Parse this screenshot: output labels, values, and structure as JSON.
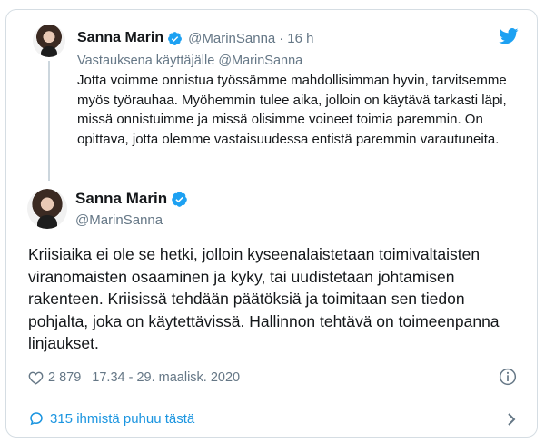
{
  "parent": {
    "name": "Sanna Marin",
    "handle": "@MarinSanna",
    "separator": "·",
    "time": "16 h",
    "replying_prefix": "Vastauksena käyttäjälle",
    "replying_to": "@MarinSanna",
    "text": "Jotta voimme onnistua työssämme mahdollisimman hyvin, tarvitsemme myös työrauhaa. Myöhemmin tulee aika, jolloin on käytävä tarkasti läpi, missä onnistuimme ja missä olisimme voineet toimia paremmin. On opittava, jotta olemme vastaisuudessa entistä paremmin varautuneita."
  },
  "tweet": {
    "name": "Sanna Marin",
    "handle": "@MarinSanna",
    "text": "Kriisiaika ei ole se hetki, jolloin kyseenalaistetaan toimivaltaisten viranomaisten osaaminen ja kyky, tai uudistetaan johtamisen rakenteen. Kriisissä tehdään päätöksiä ja toimitaan sen tiedon pohjalta, joka on käytettävissä. Hallinnon tehtävä on toimeenpanna linjaukset.",
    "likes": "2 879",
    "timestamp": "17.34 - 29. maalisk. 2020"
  },
  "conversation": {
    "label": "315 ihmistä puhuu tästä"
  },
  "icons": {
    "verified": "verified-badge-icon",
    "twitter": "twitter-bird-icon",
    "heart": "heart-icon",
    "info": "info-icon",
    "bubble": "speech-bubble-icon",
    "chevron": "chevron-right-icon"
  },
  "colors": {
    "accent": "#1da1f2",
    "link": "#1b95e0",
    "muted": "#657786",
    "text": "#14171a"
  }
}
